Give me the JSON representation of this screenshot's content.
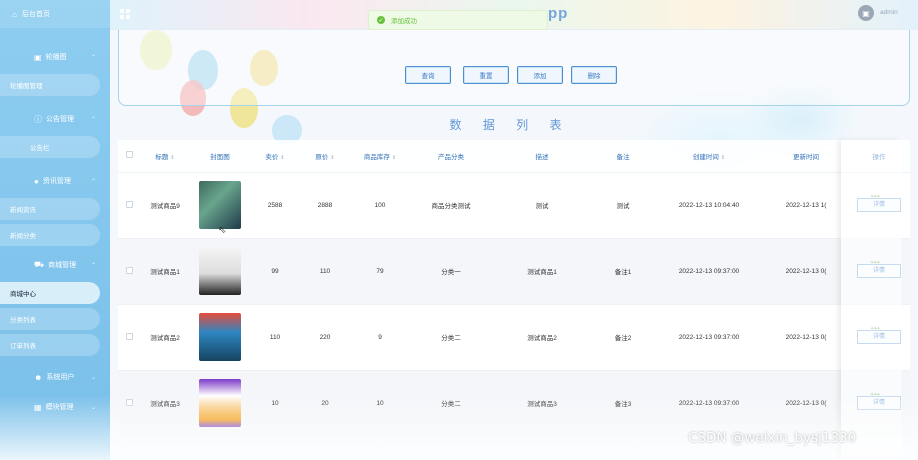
{
  "sidebar": {
    "home": "后台首页",
    "groups": [
      {
        "label": "轮播图",
        "items": [
          "轮播图管理"
        ]
      },
      {
        "label": "公告管理",
        "items": [
          "公告栏"
        ]
      },
      {
        "label": "资讯管理",
        "items": [
          "新闻资讯",
          "新闻分类"
        ]
      },
      {
        "label": "商城管理",
        "items": [
          "商城中心",
          "分类列表",
          "订单列表"
        ]
      },
      {
        "label": "系统用户",
        "items": []
      },
      {
        "label": "模块管理",
        "items": []
      }
    ],
    "active_item": "商城中心"
  },
  "topbar": {
    "app_title": "pp",
    "username": "admin"
  },
  "toast": {
    "message": "添加成功"
  },
  "toolbar": {
    "search_label": "查询",
    "reset_label": "重置",
    "add_label": "添加",
    "delete_label": "删除"
  },
  "list_title": "数 据 列 表",
  "table": {
    "columns": [
      "标题",
      "封面图",
      "卖价",
      "原价",
      "商品库存",
      "产品分类",
      "描述",
      "备注",
      "创建时间",
      "更新时间",
      "操作"
    ],
    "rows": [
      {
        "title": "测试商品9",
        "price": "2588",
        "original_price": "2888",
        "stock": "100",
        "category": "商品分类测试",
        "desc": "测试",
        "remark": "测试",
        "created": "2022-12-13 10:04:40",
        "updated": "2022-12-13 1(",
        "action": "详情"
      },
      {
        "title": "测试商品1",
        "price": "99",
        "original_price": "110",
        "stock": "79",
        "category": "分类一",
        "desc": "测试商品1",
        "remark": "备注1",
        "created": "2022-12-13 09:37:00",
        "updated": "2022-12-13 0(",
        "action": "详情"
      },
      {
        "title": "测试商品2",
        "price": "110",
        "original_price": "220",
        "stock": "9",
        "category": "分类二",
        "desc": "测试商品2",
        "remark": "备注2",
        "created": "2022-12-13 09:37:00",
        "updated": "2022-12-13 0(",
        "action": "详情"
      },
      {
        "title": "测试商品3",
        "price": "10",
        "original_price": "20",
        "stock": "10",
        "category": "分类二",
        "desc": "测试商品3",
        "remark": "备注3",
        "created": "2022-12-13 09:37:00",
        "updated": "2022-12-13 0(",
        "action": "详情"
      }
    ]
  },
  "watermark": "CSDN @weixin_bysj1330",
  "colors": {
    "sidebar_bg": "#86c8ef",
    "accent": "#3a7bc8",
    "toast_green": "#67c23a"
  }
}
